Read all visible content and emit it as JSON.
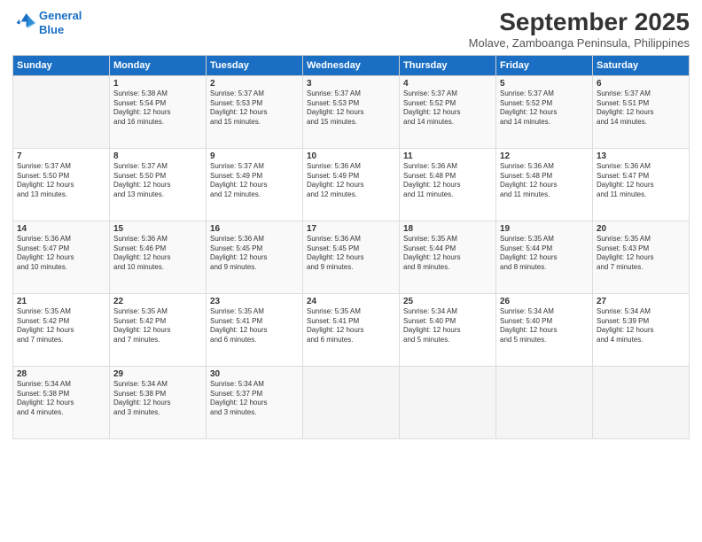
{
  "logo": {
    "line1": "General",
    "line2": "Blue"
  },
  "title": "September 2025",
  "subtitle": "Molave, Zamboanga Peninsula, Philippines",
  "header_days": [
    "Sunday",
    "Monday",
    "Tuesday",
    "Wednesday",
    "Thursday",
    "Friday",
    "Saturday"
  ],
  "weeks": [
    [
      {
        "day": "",
        "text": ""
      },
      {
        "day": "1",
        "text": "Sunrise: 5:38 AM\nSunset: 5:54 PM\nDaylight: 12 hours\nand 16 minutes."
      },
      {
        "day": "2",
        "text": "Sunrise: 5:37 AM\nSunset: 5:53 PM\nDaylight: 12 hours\nand 15 minutes."
      },
      {
        "day": "3",
        "text": "Sunrise: 5:37 AM\nSunset: 5:53 PM\nDaylight: 12 hours\nand 15 minutes."
      },
      {
        "day": "4",
        "text": "Sunrise: 5:37 AM\nSunset: 5:52 PM\nDaylight: 12 hours\nand 14 minutes."
      },
      {
        "day": "5",
        "text": "Sunrise: 5:37 AM\nSunset: 5:52 PM\nDaylight: 12 hours\nand 14 minutes."
      },
      {
        "day": "6",
        "text": "Sunrise: 5:37 AM\nSunset: 5:51 PM\nDaylight: 12 hours\nand 14 minutes."
      }
    ],
    [
      {
        "day": "7",
        "text": "Sunrise: 5:37 AM\nSunset: 5:50 PM\nDaylight: 12 hours\nand 13 minutes."
      },
      {
        "day": "8",
        "text": "Sunrise: 5:37 AM\nSunset: 5:50 PM\nDaylight: 12 hours\nand 13 minutes."
      },
      {
        "day": "9",
        "text": "Sunrise: 5:37 AM\nSunset: 5:49 PM\nDaylight: 12 hours\nand 12 minutes."
      },
      {
        "day": "10",
        "text": "Sunrise: 5:36 AM\nSunset: 5:49 PM\nDaylight: 12 hours\nand 12 minutes."
      },
      {
        "day": "11",
        "text": "Sunrise: 5:36 AM\nSunset: 5:48 PM\nDaylight: 12 hours\nand 11 minutes."
      },
      {
        "day": "12",
        "text": "Sunrise: 5:36 AM\nSunset: 5:48 PM\nDaylight: 12 hours\nand 11 minutes."
      },
      {
        "day": "13",
        "text": "Sunrise: 5:36 AM\nSunset: 5:47 PM\nDaylight: 12 hours\nand 11 minutes."
      }
    ],
    [
      {
        "day": "14",
        "text": "Sunrise: 5:36 AM\nSunset: 5:47 PM\nDaylight: 12 hours\nand 10 minutes."
      },
      {
        "day": "15",
        "text": "Sunrise: 5:36 AM\nSunset: 5:46 PM\nDaylight: 12 hours\nand 10 minutes."
      },
      {
        "day": "16",
        "text": "Sunrise: 5:36 AM\nSunset: 5:45 PM\nDaylight: 12 hours\nand 9 minutes."
      },
      {
        "day": "17",
        "text": "Sunrise: 5:36 AM\nSunset: 5:45 PM\nDaylight: 12 hours\nand 9 minutes."
      },
      {
        "day": "18",
        "text": "Sunrise: 5:35 AM\nSunset: 5:44 PM\nDaylight: 12 hours\nand 8 minutes."
      },
      {
        "day": "19",
        "text": "Sunrise: 5:35 AM\nSunset: 5:44 PM\nDaylight: 12 hours\nand 8 minutes."
      },
      {
        "day": "20",
        "text": "Sunrise: 5:35 AM\nSunset: 5:43 PM\nDaylight: 12 hours\nand 7 minutes."
      }
    ],
    [
      {
        "day": "21",
        "text": "Sunrise: 5:35 AM\nSunset: 5:42 PM\nDaylight: 12 hours\nand 7 minutes."
      },
      {
        "day": "22",
        "text": "Sunrise: 5:35 AM\nSunset: 5:42 PM\nDaylight: 12 hours\nand 7 minutes."
      },
      {
        "day": "23",
        "text": "Sunrise: 5:35 AM\nSunset: 5:41 PM\nDaylight: 12 hours\nand 6 minutes."
      },
      {
        "day": "24",
        "text": "Sunrise: 5:35 AM\nSunset: 5:41 PM\nDaylight: 12 hours\nand 6 minutes."
      },
      {
        "day": "25",
        "text": "Sunrise: 5:34 AM\nSunset: 5:40 PM\nDaylight: 12 hours\nand 5 minutes."
      },
      {
        "day": "26",
        "text": "Sunrise: 5:34 AM\nSunset: 5:40 PM\nDaylight: 12 hours\nand 5 minutes."
      },
      {
        "day": "27",
        "text": "Sunrise: 5:34 AM\nSunset: 5:39 PM\nDaylight: 12 hours\nand 4 minutes."
      }
    ],
    [
      {
        "day": "28",
        "text": "Sunrise: 5:34 AM\nSunset: 5:38 PM\nDaylight: 12 hours\nand 4 minutes."
      },
      {
        "day": "29",
        "text": "Sunrise: 5:34 AM\nSunset: 5:38 PM\nDaylight: 12 hours\nand 3 minutes."
      },
      {
        "day": "30",
        "text": "Sunrise: 5:34 AM\nSunset: 5:37 PM\nDaylight: 12 hours\nand 3 minutes."
      },
      {
        "day": "",
        "text": ""
      },
      {
        "day": "",
        "text": ""
      },
      {
        "day": "",
        "text": ""
      },
      {
        "day": "",
        "text": ""
      }
    ]
  ]
}
